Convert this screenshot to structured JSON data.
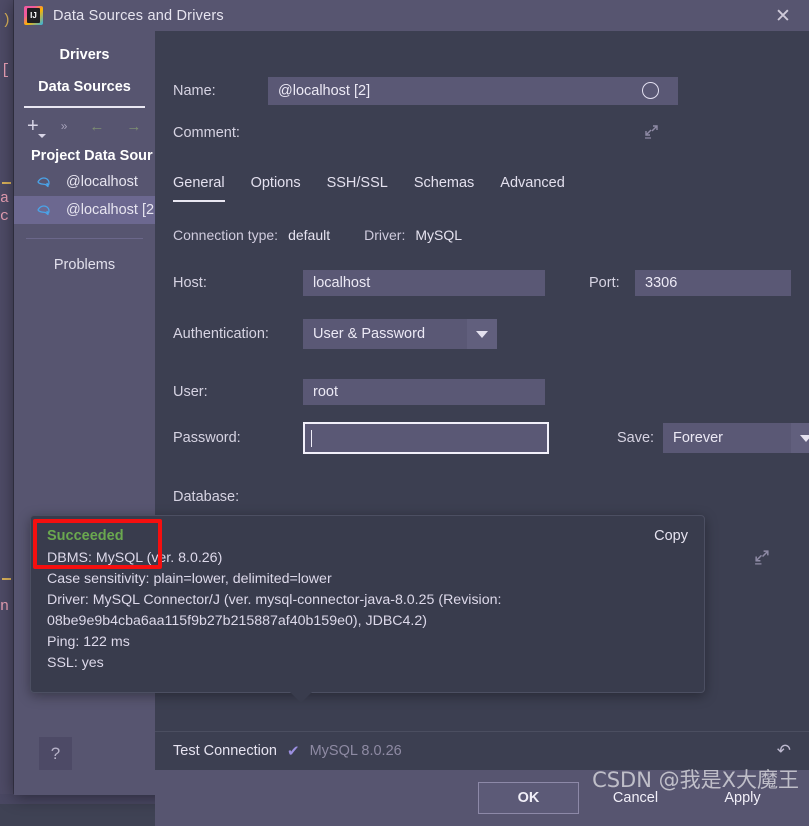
{
  "window": {
    "title": "Data Sources and Drivers",
    "app_icon": "intellij-idea-icon",
    "close_icon": "close-icon"
  },
  "sidebar": {
    "tabs": [
      {
        "label": "Drivers",
        "active": false
      },
      {
        "label": "Data Sources",
        "active": true
      }
    ],
    "toolbar": [
      {
        "name": "add-icon",
        "glyph": "+"
      },
      {
        "name": "chevrons-right-icon",
        "glyph": "»"
      },
      {
        "name": "arrow-left-icon",
        "glyph": "←"
      },
      {
        "name": "arrow-right-icon",
        "glyph": "→"
      }
    ],
    "group_title": "Project Data Sour",
    "items": [
      {
        "label": "@localhost",
        "icon": "mysql-dolphin-icon",
        "selected": false
      },
      {
        "label": "@localhost [2",
        "icon": "mysql-dolphin-icon",
        "selected": true
      }
    ],
    "problems_label": "Problems",
    "help_label": "?"
  },
  "form": {
    "name_label": "Name:",
    "name_value": "@localhost [2]",
    "name_status_icon": "circle-status-icon",
    "comment_label": "Comment:",
    "comment_value": "",
    "comment_expand_icon": "expand-icon"
  },
  "tabs": [
    {
      "label": "General",
      "active": true
    },
    {
      "label": "Options",
      "active": false
    },
    {
      "label": "SSH/SSL",
      "active": false
    },
    {
      "label": "Schemas",
      "active": false
    },
    {
      "label": "Advanced",
      "active": false
    }
  ],
  "connection_meta": {
    "conn_type_label": "Connection type:",
    "conn_type_value": "default",
    "driver_label": "Driver:",
    "driver_value": "MySQL"
  },
  "fields": {
    "host_label": "Host:",
    "host_value": "localhost",
    "port_label": "Port:",
    "port_value": "3306",
    "auth_label": "Authentication:",
    "auth_value": "User & Password",
    "user_label": "User:",
    "user_value": "root",
    "password_label": "Password:",
    "password_value": "",
    "save_label": "Save:",
    "save_value": "Forever",
    "database_label": "Database:",
    "database_value": "",
    "right_expand_icon": "expand-icon"
  },
  "result_balloon": {
    "status": "Succeeded",
    "status_color": "#6aa84f",
    "copy_label": "Copy",
    "lines": [
      "DBMS: MySQL (ver. 8.0.26)",
      "Case sensitivity: plain=lower, delimited=lower",
      "Driver: MySQL Connector/J (ver. mysql-connector-java-8.0.25 (Revision:",
      "08be9e9b4cba6aa115f9b27b215887af40b159e0), JDBC4.2)",
      "Ping: 122 ms",
      "SSL: yes"
    ],
    "highlight_color": "#f50f0f"
  },
  "test_bar": {
    "test_connection_label": "Test Connection",
    "check_icon": "check-icon",
    "driver_version": "MySQL 8.0.26",
    "revert_icon": "revert-arrow-icon"
  },
  "buttons": [
    {
      "label": "OK",
      "default": true
    },
    {
      "label": "Cancel",
      "default": false
    },
    {
      "label": "Apply",
      "default": false
    }
  ],
  "watermark": "CSDN @我是X大魔王",
  "background": {
    "right_paren": ")"
  }
}
